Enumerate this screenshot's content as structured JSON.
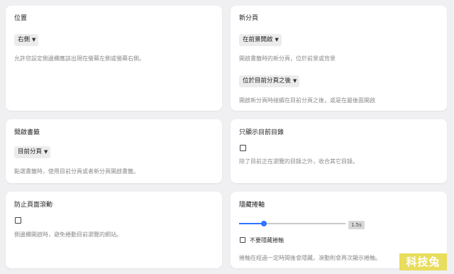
{
  "position": {
    "title": "位置",
    "select_value": "右側",
    "description": "允許您設定側邊欄應該出現在螢幕左側或螢幕右側。"
  },
  "new_tab": {
    "title": "新分頁",
    "select_value": "在前景開啟",
    "description": "開啟書籤時的新分頁，位於前景或背景",
    "position_select_value": "位於目前分頁之後",
    "position_description": "開啟新分頁時接續在目前分頁之後，或是在最後面開啟"
  },
  "open_bookmark": {
    "title": "開啟書籤",
    "select_value": "目前分頁",
    "description": "點選書籤時，使用目前分頁或者新分頁開啟書籤。"
  },
  "show_current_dir": {
    "title": "只顯示目前目錄",
    "checked": false,
    "description": "除了目前正在瀏覽的目錄之外，收合其它目錄。"
  },
  "prevent_scroll": {
    "title": "防止頁面滾動",
    "checked": false,
    "description": "側邊欄開啟時，避免捲動目前瀏覽的網站。"
  },
  "hide_scrollbar": {
    "title": "隱藏捲軸",
    "slider_value_label": "1.5s",
    "slider_fraction": 0.23,
    "checkbox_label": "不要隱藏捲軸",
    "checked": false,
    "description": "捲軸在經過一定時間後會隱藏。滾動則會再次顯示捲軸。"
  },
  "colors": {
    "accent": "#2f74ff",
    "watermark_bg": "#e8dd5c"
  },
  "watermark": "科技兔"
}
